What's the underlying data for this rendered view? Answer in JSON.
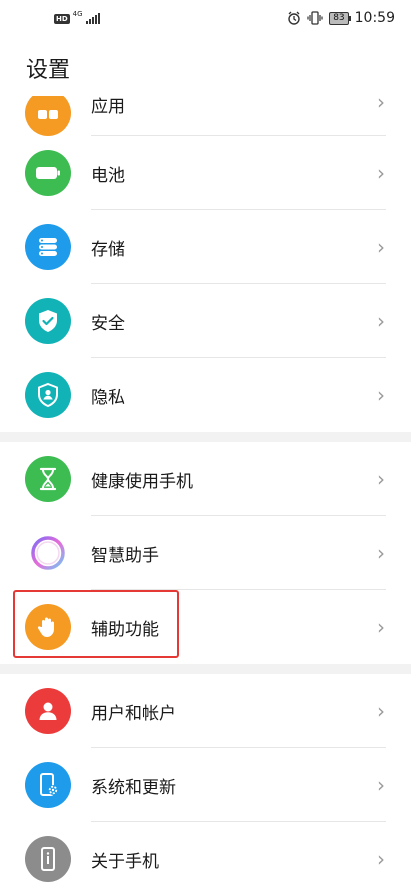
{
  "status_bar": {
    "hd": "HD",
    "network": "4G",
    "battery": "83",
    "time": "10:59"
  },
  "page": {
    "title": "设置"
  },
  "groups": [
    {
      "items": [
        {
          "label": "应用",
          "icon": "apps-icon",
          "color": "#F59A23"
        },
        {
          "label": "电池",
          "icon": "battery-icon",
          "color": "#3DBC52"
        },
        {
          "label": "存储",
          "icon": "storage-icon",
          "color": "#1E9BEA"
        },
        {
          "label": "安全",
          "icon": "shield-check-icon",
          "color": "#12B3B6"
        },
        {
          "label": "隐私",
          "icon": "privacy-shield-icon",
          "color": "#12B3B6"
        }
      ]
    },
    {
      "items": [
        {
          "label": "健康使用手机",
          "icon": "hourglass-icon",
          "color": "#3DBC52"
        },
        {
          "label": "智慧助手",
          "icon": "assistant-ring-icon",
          "color": "#ffffff"
        },
        {
          "label": "辅助功能",
          "icon": "hand-icon",
          "color": "#F59A23"
        }
      ]
    },
    {
      "items": [
        {
          "label": "用户和帐户",
          "icon": "user-icon",
          "color": "#EC3B3B"
        },
        {
          "label": "系统和更新",
          "icon": "phone-gear-icon",
          "color": "#1E9BEA"
        },
        {
          "label": "关于手机",
          "icon": "phone-info-icon",
          "color": "#8C8C8C"
        }
      ]
    }
  ],
  "highlight_color": "#E53935"
}
